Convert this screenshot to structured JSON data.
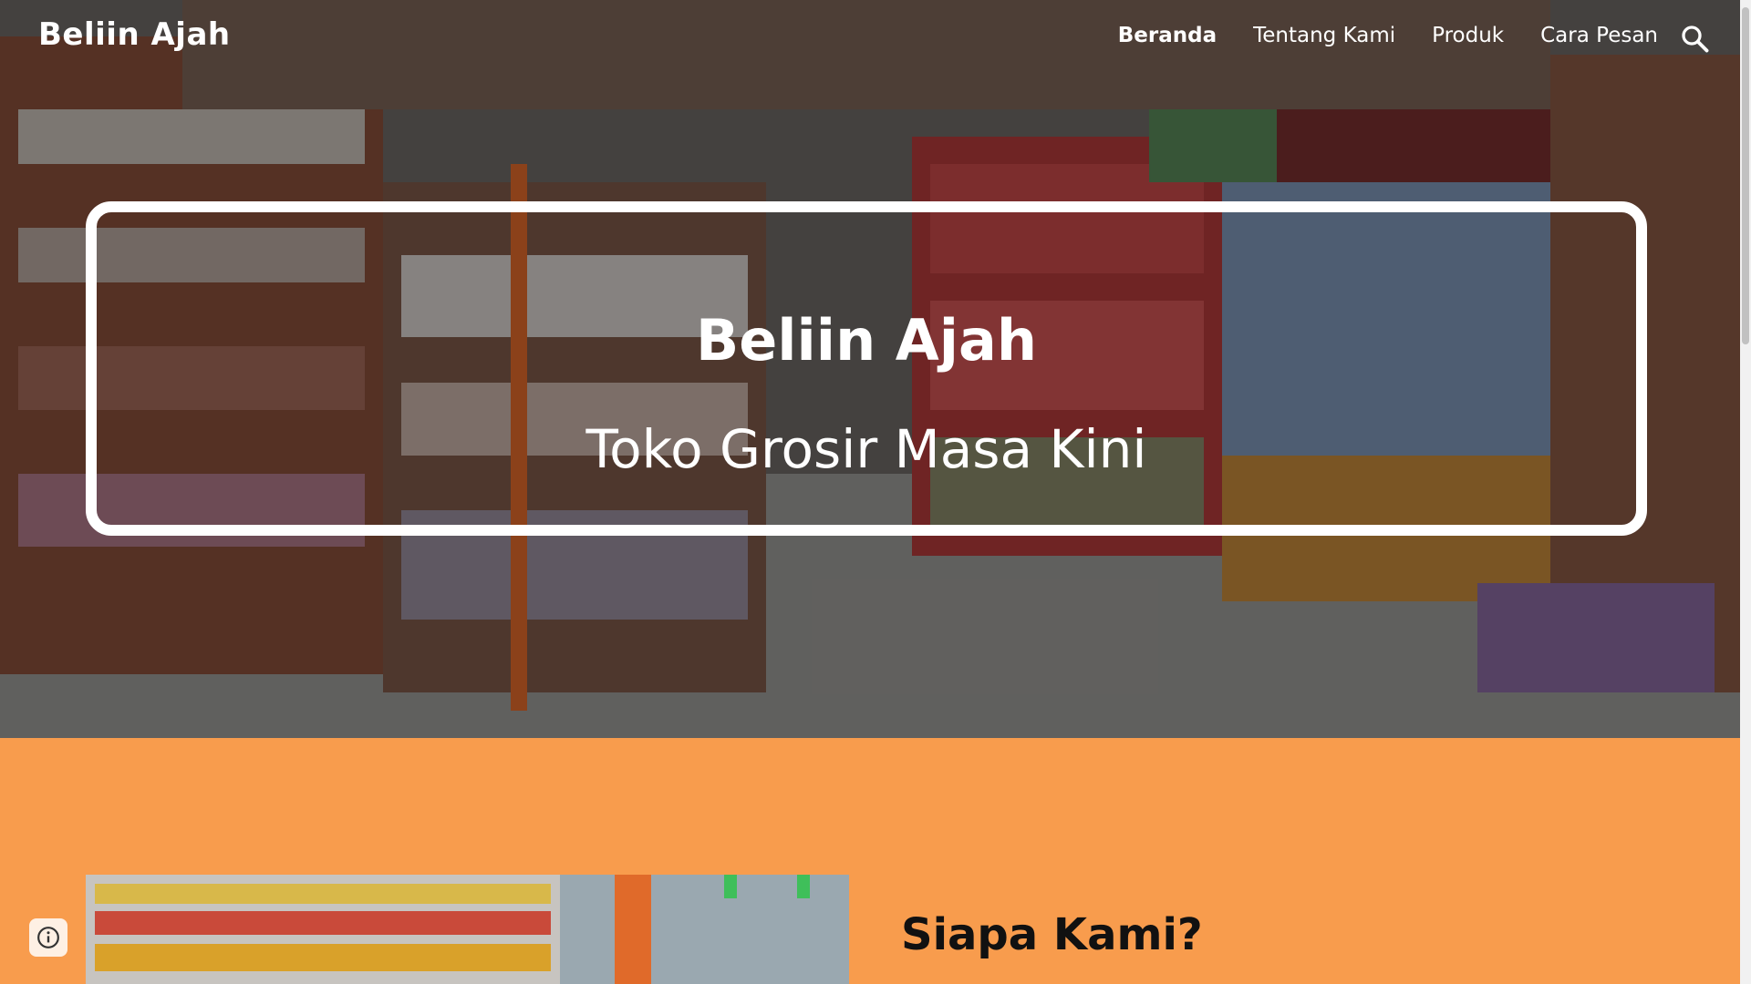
{
  "site": {
    "title": "Beliin Ajah"
  },
  "nav": {
    "items": [
      {
        "label": "Beranda",
        "active": true
      },
      {
        "label": "Tentang Kami",
        "active": false
      },
      {
        "label": "Produk",
        "active": false
      },
      {
        "label": "Cara Pesan",
        "active": false
      }
    ],
    "search_icon": "search-icon"
  },
  "hero": {
    "title": "Beliin Ajah",
    "subtitle": "Toko Grosir Masa Kini"
  },
  "about": {
    "heading": "Siapa Kami?"
  },
  "colors": {
    "section_background": "#f89c4d",
    "frame": "#ffffff",
    "text_light": "#ffffff",
    "heading_dark": "#111111"
  },
  "icons": {
    "info": "info-icon"
  }
}
